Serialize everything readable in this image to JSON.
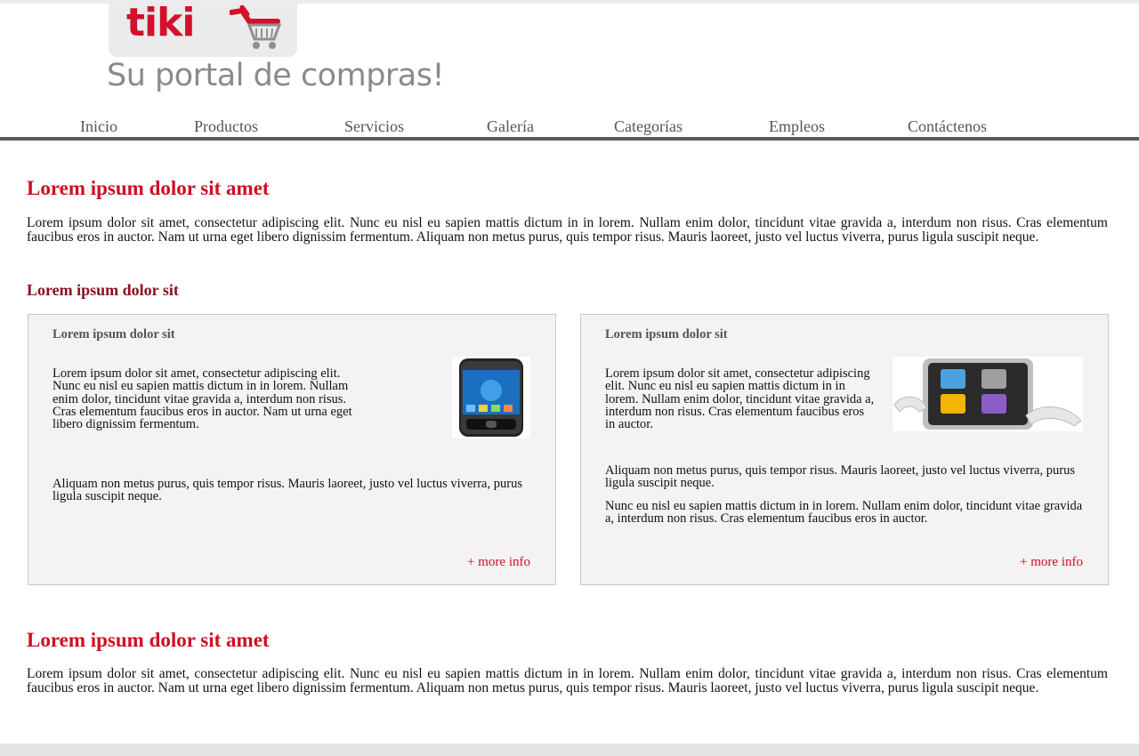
{
  "brand": {
    "logo_text": "tiki",
    "tagline": "Su portal de compras!",
    "logo_color": "#d2112c"
  },
  "nav": {
    "items": [
      {
        "label": "Inicio"
      },
      {
        "label": "Productos"
      },
      {
        "label": "Servicios"
      },
      {
        "label": "Galería"
      },
      {
        "label": "Categorías"
      },
      {
        "label": "Empleos"
      },
      {
        "label": "Contáctenos"
      }
    ]
  },
  "section1": {
    "title": "Lorem ipsum dolor sit amet",
    "body": "Lorem ipsum dolor sit amet, consectetur adipiscing elit. Nunc eu nisl eu sapien mattis dictum in in lorem. Nullam enim dolor, tincidunt vitae gravida a, interdum non risus. Cras elementum faucibus eros in auctor. Nam ut urna eget libero dignissim fermentum. Aliquam non metus purus, quis tempor risus. Mauris laoreet, justo vel luctus viverra, purus ligula suscipit neque."
  },
  "featured": {
    "title": "Lorem ipsum dolor sit",
    "cards": [
      {
        "title": "Lorem ipsum dolor sit",
        "para1": "Lorem ipsum dolor sit amet, consectetur adipiscing elit. Nunc eu nisl eu sapien mattis dictum in in lorem. Nullam enim dolor, tincidunt vitae gravida a, interdum non risus. Cras elementum faucibus eros in auctor. Nam ut urna eget libero dignissim fermentum.",
        "para2": "Aliquam non metus purus, quis tempor risus. Mauris laoreet, justo vel luctus viverra, purus ligula suscipit neque.",
        "more_label": "+ more info",
        "image": "smartphone-image"
      },
      {
        "title": "Lorem ipsum dolor sit",
        "para1": "Lorem ipsum dolor sit amet, consectetur adipiscing elit. Nunc eu nisl eu sapien mattis dictum in in lorem. Nullam enim dolor, tincidunt vitae gravida a, interdum non risus. Cras elementum faucibus eros in auctor.",
        "para2": "Aliquam non metus purus, quis tempor risus. Mauris laoreet, justo vel luctus viverra, purus ligula suscipit neque.",
        "para3": "Nunc eu nisl eu sapien mattis dictum in in lorem. Nullam enim dolor, tincidunt vitae gravida a, interdum non risus. Cras elementum faucibus eros in auctor.",
        "more_label": "+ more info",
        "image": "media-player-image"
      }
    ]
  },
  "section2": {
    "title": "Lorem ipsum dolor sit amet",
    "body": "Lorem ipsum dolor sit amet, consectetur adipiscing elit. Nunc eu nisl eu sapien mattis dictum in in lorem. Nullam enim dolor, tincidunt vitae gravida a, interdum non risus. Cras elementum faucibus eros in auctor. Nam ut urna eget libero dignissim fermentum. Aliquam non metus purus, quis tempor risus. Mauris laoreet, justo vel luctus viverra, purus ligula suscipit neque."
  },
  "colors": {
    "accent": "#cc1024",
    "subheading": "#8a0e1e",
    "nav_bar": "#5b5b5b",
    "card_bg": "#f4f2f3"
  }
}
